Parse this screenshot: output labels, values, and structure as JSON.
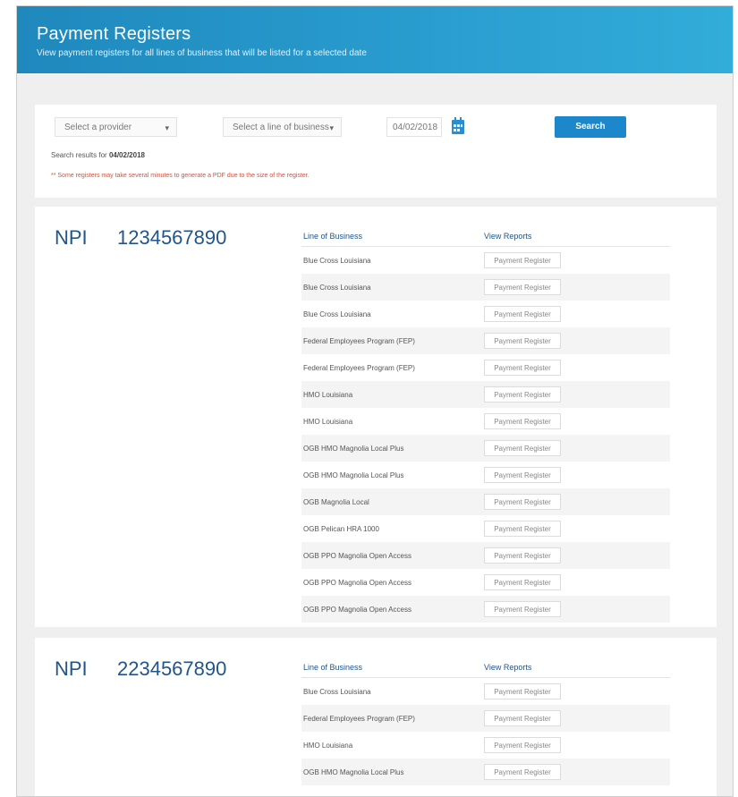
{
  "header": {
    "title": "Payment Registers",
    "subtitle": "View payment registers for all lines of business that will be listed for a selected date"
  },
  "search": {
    "provider_placeholder": "Select a provider",
    "lob_placeholder": "Select a line of business",
    "date_value": "04/02/2018",
    "search_label": "Search",
    "results_prefix": "Search results for",
    "results_date": "04/02/2018",
    "warning": "** Some registers may take several minutes to generate a PDF due to the size of the register."
  },
  "columns": {
    "lob": "Line of Business",
    "reports": "View Reports"
  },
  "npi_label": "NPI",
  "groups": [
    {
      "npi": "1234567890",
      "rows": [
        {
          "lob": "Blue Cross Louisiana",
          "action": "Payment Register"
        },
        {
          "lob": "Blue Cross Louisiana",
          "action": "Payment Register"
        },
        {
          "lob": "Blue Cross Louisiana",
          "action": "Payment Register"
        },
        {
          "lob": "Federal Employees Program (FEP)",
          "action": "Payment Register"
        },
        {
          "lob": "Federal Employees Program (FEP)",
          "action": "Payment Register"
        },
        {
          "lob": "HMO Louisiana",
          "action": "Payment Register"
        },
        {
          "lob": "HMO Louisiana",
          "action": "Payment Register"
        },
        {
          "lob": "OGB HMO Magnolia Local Plus",
          "action": "Payment Register"
        },
        {
          "lob": "OGB HMO Magnolia Local Plus",
          "action": "Payment Register"
        },
        {
          "lob": "OGB Magnolia Local",
          "action": "Payment Register"
        },
        {
          "lob": "OGB Pelican HRA 1000",
          "action": "Payment Register"
        },
        {
          "lob": "OGB PPO Magnolia Open Access",
          "action": "Payment Register"
        },
        {
          "lob": "OGB PPO Magnolia Open Access",
          "action": "Payment Register"
        },
        {
          "lob": "OGB PPO Magnolia Open Access",
          "action": "Payment Register"
        }
      ]
    },
    {
      "npi": "2234567890",
      "rows": [
        {
          "lob": "Blue Cross Louisiana",
          "action": "Payment Register"
        },
        {
          "lob": "Federal Employees Program (FEP)",
          "action": "Payment Register"
        },
        {
          "lob": "HMO Louisiana",
          "action": "Payment Register"
        },
        {
          "lob": "OGB HMO Magnolia Local Plus",
          "action": "Payment Register"
        }
      ]
    }
  ],
  "colors": {
    "header_blue": "#1f88bd",
    "button_blue": "#1d87cc",
    "npi_text": "#21558c",
    "warning_red": "#d2523c"
  },
  "icons": {
    "calendar": "calendar-icon",
    "dropdown": "chevron-down-icon"
  }
}
